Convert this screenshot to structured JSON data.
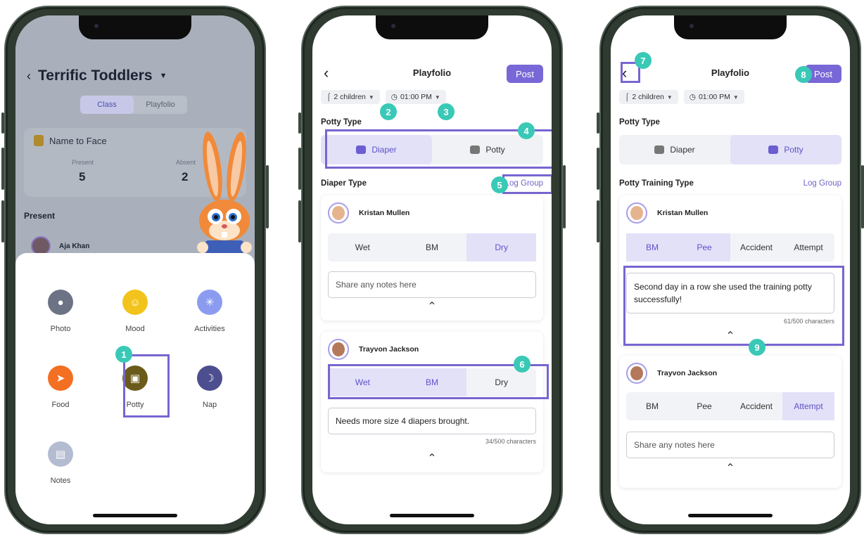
{
  "phone1": {
    "class_title": "Terrific Toddlers",
    "tabs": [
      "Class",
      "Playfolio"
    ],
    "name_to_face": {
      "title": "Name to Face",
      "present_label": "Present",
      "present_value": "5",
      "absent_label": "Absent",
      "absent_value": "2"
    },
    "present_heading": "Present",
    "first_child": "Aja Khan",
    "activities": [
      {
        "label": "Photo",
        "icon": "camera-icon",
        "color": "#6c7385"
      },
      {
        "label": "Mood",
        "icon": "smile-icon",
        "color": "#f2c41b"
      },
      {
        "label": "Activities",
        "icon": "running-icon",
        "color": "#8b9cf0"
      },
      {
        "label": "Food",
        "icon": "carrot-icon",
        "color": "#f36f21"
      },
      {
        "label": "Potty",
        "icon": "toilet-icon",
        "color": "#6b5b1b"
      },
      {
        "label": "Nap",
        "icon": "moon-icon",
        "color": "#4d4e8f"
      },
      {
        "label": "Notes",
        "icon": "notes-icon",
        "color": "#b4bcd2"
      }
    ]
  },
  "phone2": {
    "title": "Playfolio",
    "post_label": "Post",
    "children_chip": "2 children",
    "time_chip": "01:00 PM",
    "potty_type_label": "Potty Type",
    "potty_options": [
      "Diaper",
      "Potty"
    ],
    "selected_potty": "Diaper",
    "diaper_type_label": "Diaper Type",
    "log_group": "Log Group",
    "entries": [
      {
        "name": "Kristan Mullen",
        "options": [
          "Wet",
          "BM",
          "Dry"
        ],
        "selected": [
          "Dry"
        ],
        "notes_placeholder": "Share any notes here",
        "notes": "",
        "counter": ""
      },
      {
        "name": "Trayvon Jackson",
        "options": [
          "Wet",
          "BM",
          "Dry"
        ],
        "selected": [
          "Wet",
          "BM"
        ],
        "notes": "Needs more size 4 diapers brought.",
        "counter": "34/500 characters"
      }
    ]
  },
  "phone3": {
    "title": "Playfolio",
    "post_label": "Post",
    "children_chip": "2 children",
    "time_chip": "01:00 PM",
    "potty_type_label": "Potty Type",
    "potty_options": [
      "Diaper",
      "Potty"
    ],
    "selected_potty": "Potty",
    "training_type_label": "Potty Training Type",
    "log_group": "Log Group",
    "entries": [
      {
        "name": "Kristan Mullen",
        "options": [
          "BM",
          "Pee",
          "Accident",
          "Attempt"
        ],
        "selected": [
          "BM",
          "Pee"
        ],
        "notes": "Second day in a row she used the training potty successfully!",
        "counter": "61/500 characters"
      },
      {
        "name": "Trayvon Jackson",
        "options": [
          "BM",
          "Pee",
          "Accident",
          "Attempt"
        ],
        "selected": [
          "Attempt"
        ],
        "notes_placeholder": "Share any notes here",
        "notes": "",
        "counter": ""
      }
    ]
  },
  "badges": [
    "1",
    "2",
    "3",
    "4",
    "5",
    "6",
    "7",
    "8",
    "9"
  ],
  "colors": {
    "accent": "#7867d6",
    "highlight": "#7865d0",
    "badge": "#39c9b6",
    "selected_bg": "#e3e1f8"
  }
}
